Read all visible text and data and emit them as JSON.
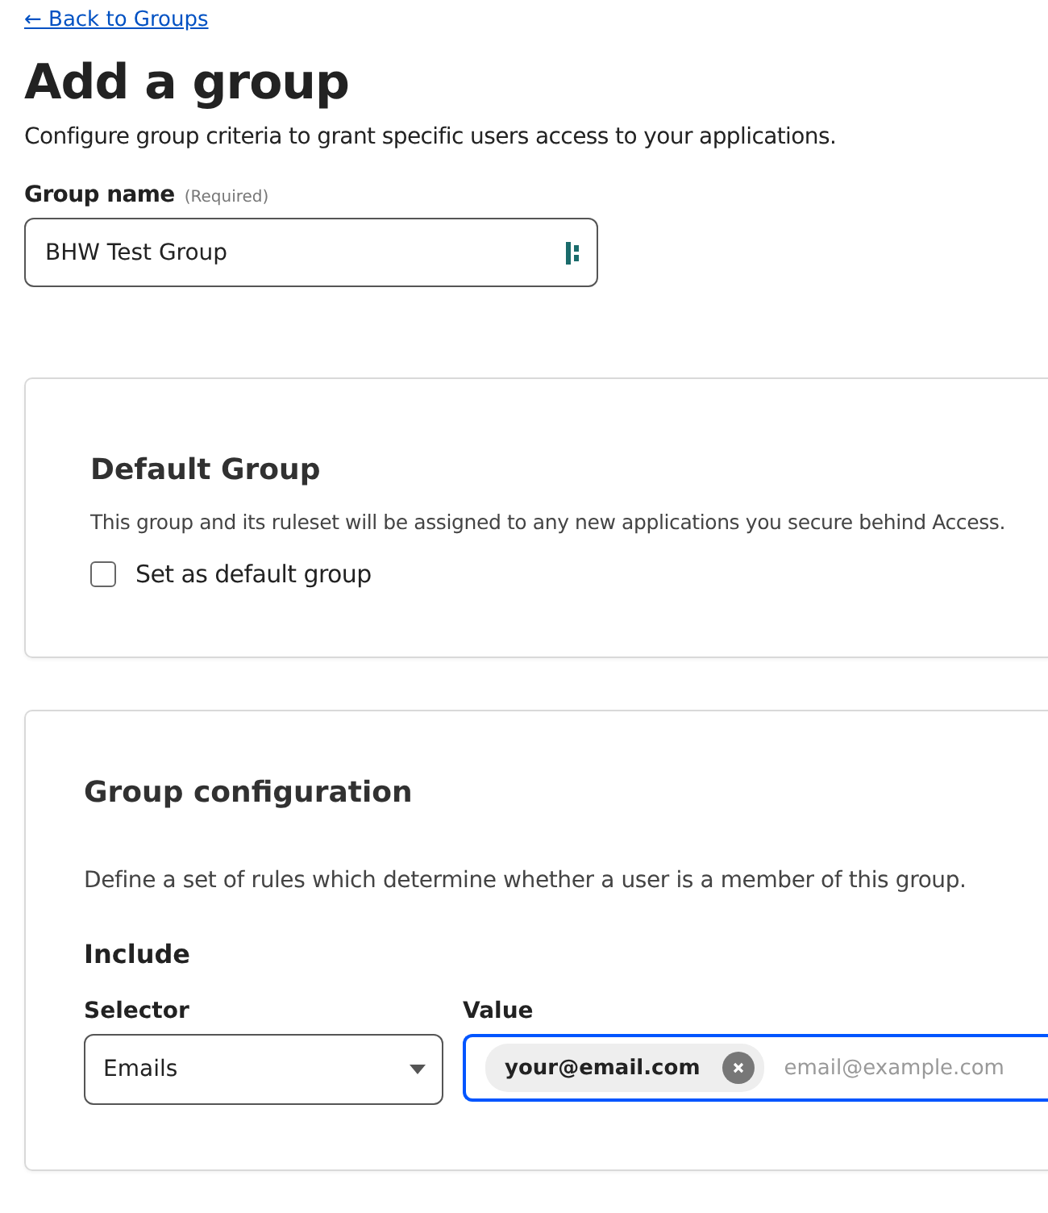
{
  "back_link": "← Back to Groups",
  "title": "Add a group",
  "subtitle": "Configure group criteria to grant specific users access to your applications.",
  "group_name": {
    "label": "Group name",
    "required_note": "(Required)",
    "value": "BHW Test Group"
  },
  "default_group": {
    "heading": "Default Group",
    "description": "This group and its ruleset will be assigned to any new applications you secure behind Access.",
    "checkbox": {
      "label": "Set as default group",
      "checked": false
    }
  },
  "group_configuration": {
    "heading": "Group configuration",
    "description": "Define a set of rules which determine whether a user is a member of this group.",
    "include": {
      "heading": "Include",
      "selector": {
        "label": "Selector",
        "value": "Emails"
      },
      "value": {
        "label": "Value",
        "focused": true,
        "chips": [
          "your@email.com"
        ],
        "placeholder": "email@example.com"
      }
    }
  }
}
